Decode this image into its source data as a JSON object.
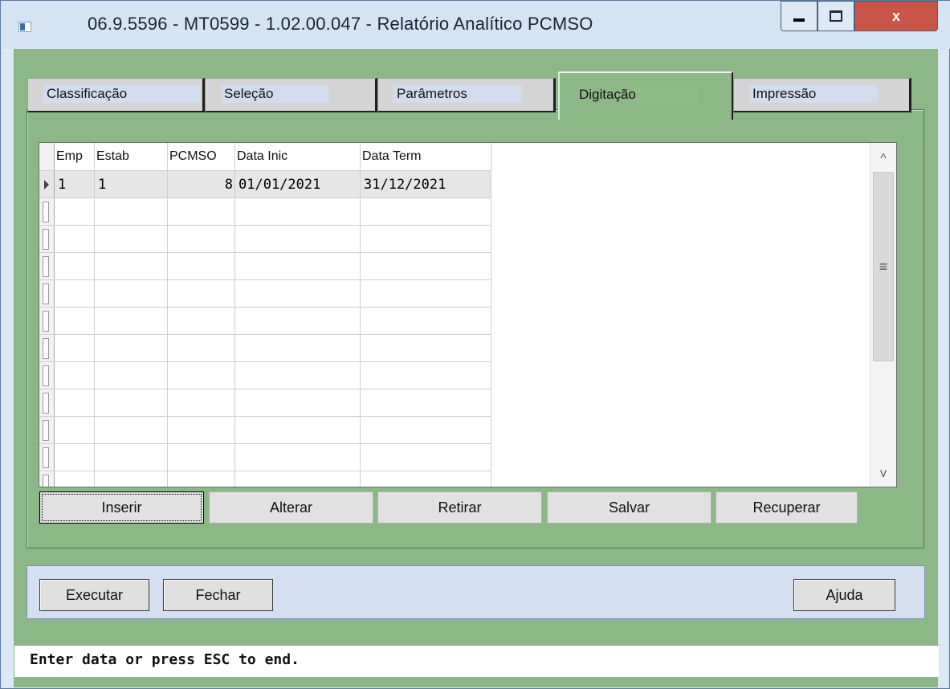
{
  "window": {
    "title": "06.9.5596 - MT0599 - 1.02.00.047 - Relatório Analítico PCMSO",
    "close_glyph": "x"
  },
  "tabs": [
    {
      "label": "Classificação",
      "active": false
    },
    {
      "label": "Seleção",
      "active": false
    },
    {
      "label": "Parâmetros",
      "active": false
    },
    {
      "label": "Digitação",
      "active": true
    },
    {
      "label": "Impressão",
      "active": false
    }
  ],
  "grid": {
    "columns": [
      "Emp",
      "Estab",
      "PCMSO",
      "Data Inic",
      "Data Term"
    ],
    "rows": [
      {
        "emp": "1",
        "estab": "1",
        "pcmso": "8",
        "data_inic": "01/01/2021",
        "data_term": "31/12/2021"
      }
    ],
    "scroll_up_glyph": "^",
    "scroll_down_glyph": "v",
    "scroll_thumb_glyph": "≡"
  },
  "grid_buttons": {
    "inserir": "Inserir",
    "alterar": "Alterar",
    "retirar": "Retirar",
    "salvar": "Salvar",
    "recuperar": "Recuperar"
  },
  "footer_buttons": {
    "executar": "Executar",
    "fechar": "Fechar",
    "ajuda": "Ajuda"
  },
  "status_bar": {
    "message": "Enter data or press ESC to end."
  },
  "colors": {
    "client_bg": "#8cb887",
    "title_bg": "#d4e4f5",
    "close_bg": "#c95549",
    "bottom_panel_bg": "#d4dff2"
  }
}
